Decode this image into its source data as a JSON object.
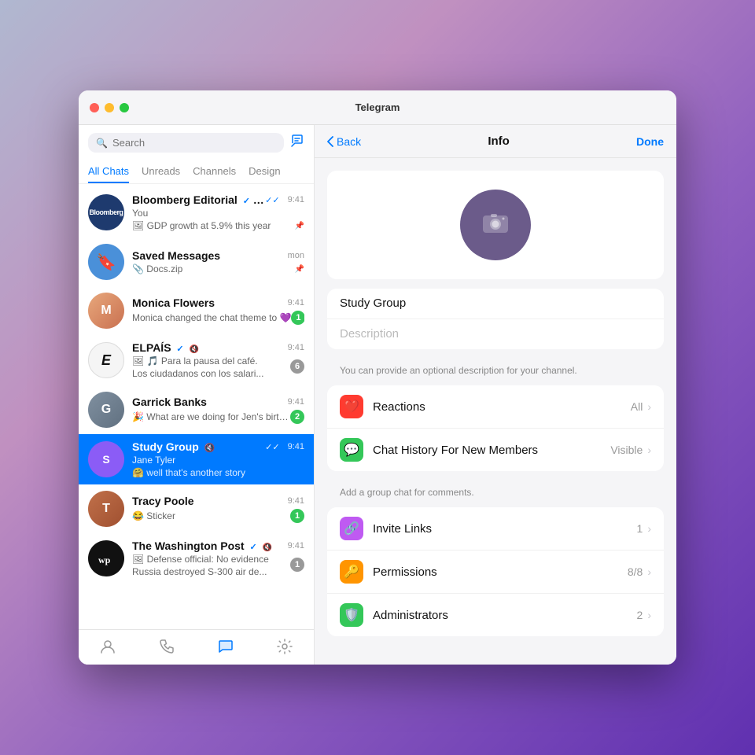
{
  "window": {
    "title": "Telegram"
  },
  "sidebar": {
    "search_placeholder": "Search",
    "tabs": [
      "All Chats",
      "Unreads",
      "Channels",
      "Design"
    ],
    "active_tab": "All Chats",
    "chats": [
      {
        "id": "bloomberg",
        "name": "Bloomberg Editorial",
        "avatar_text": "Bloomberg",
        "avatar_class": "av-bloomberg",
        "time": "9:41",
        "preview": "You",
        "preview2": "🖼 GDP growth at 5.9% this year",
        "verified": true,
        "muted": false,
        "pinned": true,
        "check": true,
        "badge": null
      },
      {
        "id": "saved",
        "name": "Saved Messages",
        "avatar_text": "🔖",
        "avatar_class": "av-saved",
        "time": "mon",
        "preview": "📎 Docs.zip",
        "pinned": true,
        "badge": null
      },
      {
        "id": "monica",
        "name": "Monica Flowers",
        "avatar_text": "",
        "avatar_class": "av-monica",
        "time": "9:41",
        "preview": "Monica changed the chat theme to 💜",
        "badge": "1",
        "badge_type": "normal"
      },
      {
        "id": "elpais",
        "name": "ELPAÍS",
        "avatar_text": "E",
        "avatar_class": "av-elpais",
        "time": "9:41",
        "preview": "🖼 🎵 Para la pausa del café.",
        "preview2": "Los ciudadanos con los salari...",
        "verified": true,
        "muted": true,
        "badge": "6",
        "badge_type": "muted"
      },
      {
        "id": "garrick",
        "name": "Garrick Banks",
        "avatar_text": "",
        "avatar_class": "av-garrick",
        "time": "9:41",
        "preview": "🎉 What are we doing for Jen's birthday on Friday?",
        "badge": "2",
        "badge_type": "normal"
      },
      {
        "id": "study",
        "name": "Study Group",
        "avatar_text": "S",
        "avatar_class": "av-study",
        "time": "9:41",
        "preview_name": "Jane Tyler",
        "preview": "🤗 well that's another story",
        "muted": true,
        "check": true,
        "badge": null,
        "active": true
      },
      {
        "id": "tracy",
        "name": "Tracy Poole",
        "avatar_text": "",
        "avatar_class": "av-tracy",
        "time": "9:41",
        "preview": "😂 Sticker",
        "badge": "1",
        "badge_type": "normal"
      },
      {
        "id": "wp",
        "name": "The Washington Post",
        "avatar_text": "wp",
        "avatar_class": "av-wp",
        "time": "9:41",
        "preview": "🖼 Defense official: No evidence Russia destroyed S-300 air de...",
        "verified": true,
        "muted": true,
        "badge": "1",
        "badge_type": "muted"
      }
    ],
    "bottom_nav": [
      "person",
      "phone",
      "bubble",
      "gear"
    ]
  },
  "right_panel": {
    "header": {
      "back_label": "Back",
      "title": "Info",
      "done_label": "Done"
    },
    "group_name": "Study Group",
    "description_placeholder": "Description",
    "description_hint": "You can provide an optional description for your channel.",
    "settings": [
      {
        "id": "reactions",
        "icon": "❤️",
        "icon_bg": "#ff3b30",
        "label": "Reactions",
        "value": "All"
      },
      {
        "id": "chat-history",
        "icon": "💬",
        "icon_bg": "#34c759",
        "label": "Chat History For New Members",
        "value": "Visible"
      }
    ],
    "comments_hint": "Add a group chat for comments.",
    "links": [
      {
        "id": "invite-links",
        "icon": "🔗",
        "icon_bg": "#bf5af2",
        "label": "Invite Links",
        "value": "1"
      },
      {
        "id": "permissions",
        "icon": "🔑",
        "icon_bg": "#ff9500",
        "label": "Permissions",
        "value": "8/8"
      },
      {
        "id": "administrators",
        "icon": "🛡",
        "icon_bg": "#34c759",
        "label": "Administrators",
        "value": "2"
      }
    ]
  }
}
